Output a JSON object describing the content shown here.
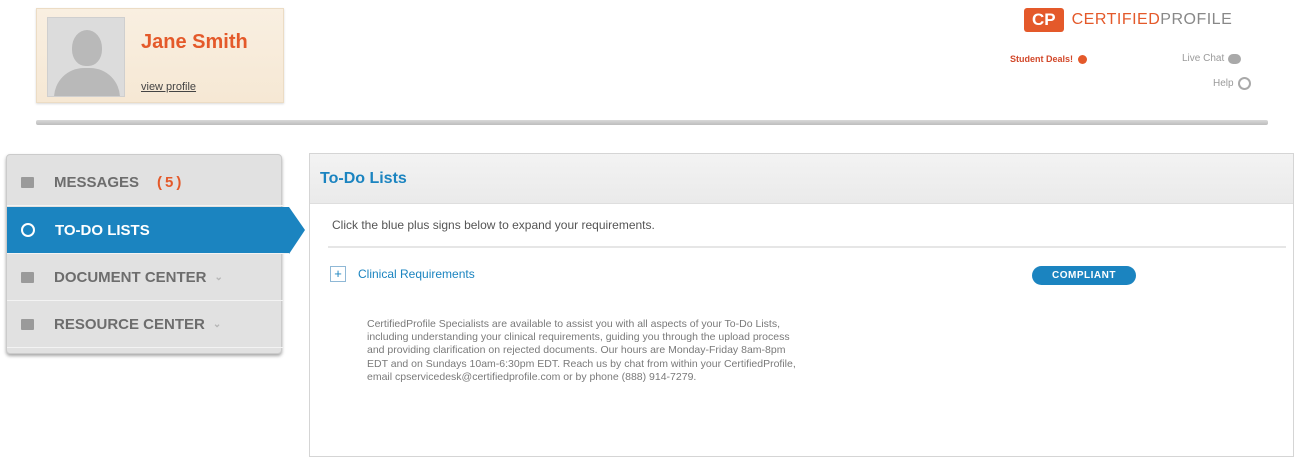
{
  "profile": {
    "name": "Jane Smith",
    "view_label": "view profile"
  },
  "brand": {
    "mark": "CP",
    "name_part1": "CERTIFIED",
    "name_part2": "PROFILE",
    "accent": "#e4592a",
    "primary": "#1b84c0"
  },
  "header_links": {
    "student_deals": "Student Deals!",
    "live_chat": "Live Chat",
    "help": "Help"
  },
  "sidebar": {
    "items": [
      {
        "label": "MESSAGES",
        "count": "(5)",
        "icon": "envelope-icon"
      },
      {
        "label": "TO-DO LISTS",
        "icon": "checklist-icon"
      },
      {
        "label": "DOCUMENT CENTER",
        "icon": "document-icon"
      },
      {
        "label": "RESOURCE CENTER",
        "icon": "briefcase-icon"
      }
    ]
  },
  "main": {
    "title": "To-Do Lists",
    "instruction": "Click the blue plus signs below to expand your requirements.",
    "requirement": {
      "label": "Clinical Requirements",
      "status": "COMPLIANT"
    },
    "description": "CertifiedProfile Specialists are available to assist you with all aspects of your To-Do Lists, including understanding your clinical requirements, guiding you through the upload process and providing clarification on rejected documents. Our hours are Monday-Friday 8am-8pm EDT and on Sundays 10am-6:30pm EDT. Reach us by chat from within your CertifiedProfile, email cpservicedesk@certifiedprofile.com or by phone (888) 914-7279."
  }
}
